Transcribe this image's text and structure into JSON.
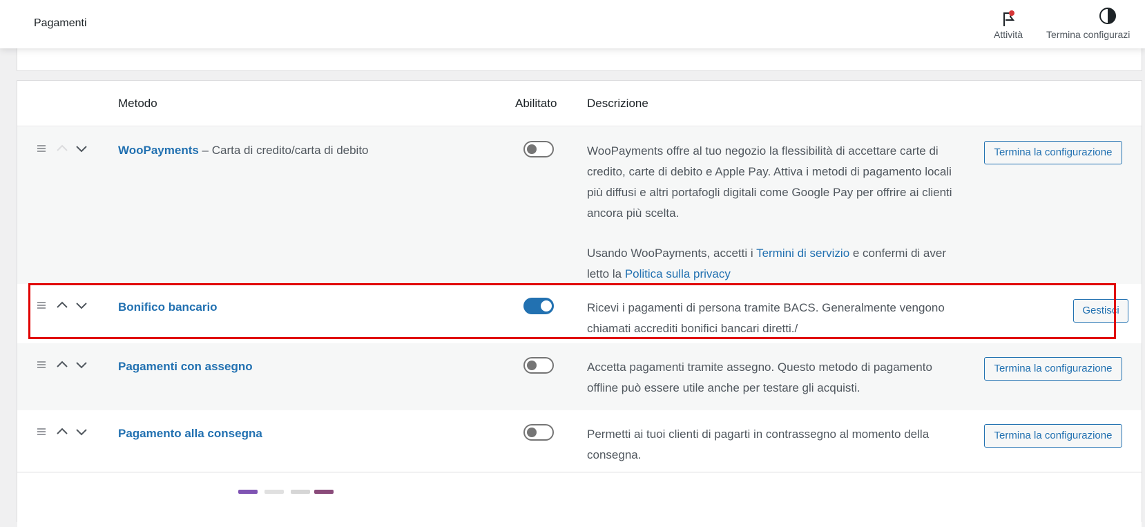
{
  "header": {
    "title": "Pagamenti",
    "activity_label": "Attività",
    "finish_setup_label": "Termina configurazi"
  },
  "table": {
    "columns": {
      "method": "Metodo",
      "enabled": "Abilitato",
      "description": "Descrizione"
    },
    "rows": [
      {
        "name": "WooPayments",
        "suffix": " – Carta di credito/carta di debito",
        "enabled": false,
        "description": "WooPayments offre al tuo negozio la flessibilità di accettare carte di credito, carte di debito e Apple Pay. Attiva i metodi di pagamento locali più diffusi e altri portafogli digitali come Google Pay per offrire ai clienti ancora più scelta.",
        "terms_prefix": "Usando WooPayments, accetti i ",
        "terms_link": "Termini di servizio",
        "terms_middle": " e confermi di aver letto la ",
        "privacy_link": "Politica sulla privacy",
        "button": "Termina la configurazione"
      },
      {
        "name": "Bonifico bancario",
        "suffix": "",
        "enabled": true,
        "description": "Ricevi i pagamenti di persona tramite BACS. Generalmente vengono chiamati accrediti bonifici bancari diretti./",
        "button": "Gestisci"
      },
      {
        "name": "Pagamenti con assegno",
        "suffix": "",
        "enabled": false,
        "description": "Accetta pagamenti tramite assegno. Questo metodo di pagamento offline può essere utile anche per testare gli acquisti.",
        "button": "Termina la configurazione"
      },
      {
        "name": "Pagamento alla consegna",
        "suffix": "",
        "enabled": false,
        "description": "Permetti ai tuoi clienti di pagarti in contrassegno al momento della consegna.",
        "button": "Termina la configurazione"
      }
    ]
  },
  "colors": {
    "link": "#2271b1",
    "highlight": "#e00000",
    "notification_dot": "#d63638"
  },
  "icons": [
    "flag-icon",
    "half-circle-icon",
    "drag-handle-icon",
    "chevron-up-icon",
    "chevron-down-icon"
  ]
}
